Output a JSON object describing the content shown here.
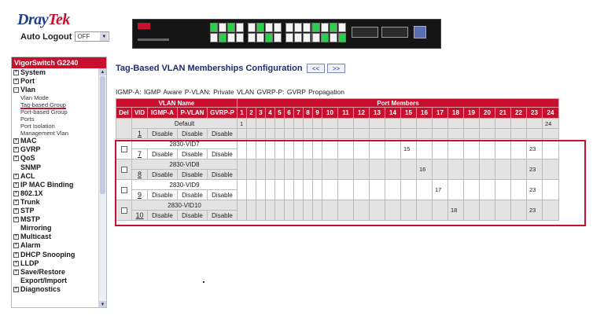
{
  "header": {
    "logo": {
      "brand_left": "Dray",
      "brand_right": "Tek"
    },
    "auto_logout": {
      "label": "Auto Logout",
      "value": "OFF"
    }
  },
  "sidebar": {
    "title": "VigorSwitch G2240",
    "items": [
      {
        "label": "System",
        "icon": "plus-box-icon"
      },
      {
        "label": "Port",
        "icon": "plus-box-icon"
      },
      {
        "label": "Vlan",
        "icon": "minus-box-icon"
      },
      {
        "sub": "Vlan Mode"
      },
      {
        "sub": "Tag-based Group",
        "active": true
      },
      {
        "sub": "Port-based Group"
      },
      {
        "sub": "Ports"
      },
      {
        "sub": "Port Isolation"
      },
      {
        "sub": "Management Vlan"
      },
      {
        "label": "MAC",
        "icon": "plus-box-icon"
      },
      {
        "label": "GVRP",
        "icon": "plus-box-icon"
      },
      {
        "label": "QoS",
        "icon": "plus-box-icon"
      },
      {
        "label": "SNMP",
        "icon": ""
      },
      {
        "label": "ACL",
        "icon": "plus-box-icon"
      },
      {
        "label": "IP MAC Binding",
        "icon": "plus-box-icon"
      },
      {
        "label": "802.1X",
        "icon": "plus-box-icon"
      },
      {
        "label": "Trunk",
        "icon": "plus-box-icon"
      },
      {
        "label": "STP",
        "icon": "plus-box-icon"
      },
      {
        "label": "MSTP",
        "icon": "plus-box-icon"
      },
      {
        "label": "Mirroring",
        "icon": ""
      },
      {
        "label": "Multicast",
        "icon": "plus-box-icon"
      },
      {
        "label": "Alarm",
        "icon": "plus-box-icon"
      },
      {
        "label": "DHCP Snooping",
        "icon": "plus-box-icon"
      },
      {
        "label": "LLDP",
        "icon": "plus-box-icon"
      },
      {
        "label": "Save/Restore",
        "icon": "plus-box-icon"
      },
      {
        "label": "Export/Import",
        "icon": ""
      },
      {
        "label": "Diagnostics",
        "icon": "plus-box-icon"
      }
    ]
  },
  "main": {
    "title": "Tag-Based VLAN Memberships Configuration",
    "prev_label": "<<",
    "next_label": ">>",
    "legend": "IGMP-A: IGMP Aware    P-VLAN: Private VLAN    GVRP-P: GVRP Propagation",
    "table": {
      "group_headers": {
        "vlan_name": "VLAN Name",
        "port_members": "Port Members"
      },
      "columns": [
        "Del",
        "VID",
        "IGMP-A",
        "P-VLAN",
        "GVRP-P"
      ],
      "ports": [
        "1",
        "2",
        "3",
        "4",
        "5",
        "6",
        "7",
        "8",
        "9",
        "10",
        "11",
        "12",
        "13",
        "14",
        "15",
        "16",
        "17",
        "18",
        "19",
        "20",
        "21",
        "22",
        "23",
        "24"
      ],
      "rows": [
        {
          "name": "Default",
          "vid": "1",
          "igmp": "Disable",
          "pvlan": "Disable",
          "gvrp": "Disable",
          "has_del": false,
          "members": [
            {
              "port": 1,
              "row": "top",
              "label": "1"
            },
            {
              "port": 24,
              "row": "top",
              "label": "24"
            }
          ]
        },
        {
          "name": "2830-VID7",
          "vid": "7",
          "igmp": "Disable",
          "pvlan": "Disable",
          "gvrp": "Disable",
          "has_del": true,
          "members": [
            {
              "port": 15,
              "row": "span",
              "label": "15"
            },
            {
              "port": 23,
              "row": "span",
              "label": "23"
            }
          ]
        },
        {
          "name": "2830-VID8",
          "vid": "8",
          "igmp": "Disable",
          "pvlan": "Disable",
          "gvrp": "Disable",
          "has_del": true,
          "members": [
            {
              "port": 16,
              "row": "span",
              "label": "16"
            },
            {
              "port": 23,
              "row": "span",
              "label": "23"
            }
          ]
        },
        {
          "name": "2830-VID9",
          "vid": "9",
          "igmp": "Disable",
          "pvlan": "Disable",
          "gvrp": "Disable",
          "has_del": true,
          "members": [
            {
              "port": 17,
              "row": "span",
              "label": "17"
            },
            {
              "port": 23,
              "row": "span",
              "label": "23"
            }
          ]
        },
        {
          "name": "2830-VID10",
          "vid": "10",
          "igmp": "Disable",
          "pvlan": "Disable",
          "gvrp": "Disable",
          "has_del": true,
          "members": [
            {
              "port": 18,
              "row": "span",
              "label": "18"
            },
            {
              "port": 23,
              "row": "span",
              "label": "23"
            }
          ]
        }
      ]
    }
  },
  "colors": {
    "brand_red": "#c8102e",
    "brand_blue": "#1d3f8f",
    "title_blue": "#1b2f6e",
    "row_gray": "#e3e3e3"
  }
}
